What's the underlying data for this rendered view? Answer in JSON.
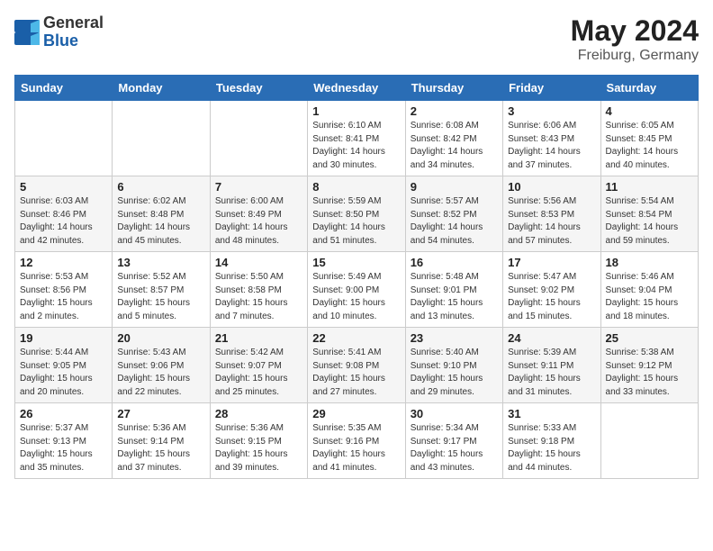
{
  "logo": {
    "general": "General",
    "blue": "Blue"
  },
  "title": {
    "month": "May 2024",
    "location": "Freiburg, Germany"
  },
  "weekdays": [
    "Sunday",
    "Monday",
    "Tuesday",
    "Wednesday",
    "Thursday",
    "Friday",
    "Saturday"
  ],
  "weeks": [
    [
      {
        "day": "",
        "info": ""
      },
      {
        "day": "",
        "info": ""
      },
      {
        "day": "",
        "info": ""
      },
      {
        "day": "1",
        "info": "Sunrise: 6:10 AM\nSunset: 8:41 PM\nDaylight: 14 hours\nand 30 minutes."
      },
      {
        "day": "2",
        "info": "Sunrise: 6:08 AM\nSunset: 8:42 PM\nDaylight: 14 hours\nand 34 minutes."
      },
      {
        "day": "3",
        "info": "Sunrise: 6:06 AM\nSunset: 8:43 PM\nDaylight: 14 hours\nand 37 minutes."
      },
      {
        "day": "4",
        "info": "Sunrise: 6:05 AM\nSunset: 8:45 PM\nDaylight: 14 hours\nand 40 minutes."
      }
    ],
    [
      {
        "day": "5",
        "info": "Sunrise: 6:03 AM\nSunset: 8:46 PM\nDaylight: 14 hours\nand 42 minutes."
      },
      {
        "day": "6",
        "info": "Sunrise: 6:02 AM\nSunset: 8:48 PM\nDaylight: 14 hours\nand 45 minutes."
      },
      {
        "day": "7",
        "info": "Sunrise: 6:00 AM\nSunset: 8:49 PM\nDaylight: 14 hours\nand 48 minutes."
      },
      {
        "day": "8",
        "info": "Sunrise: 5:59 AM\nSunset: 8:50 PM\nDaylight: 14 hours\nand 51 minutes."
      },
      {
        "day": "9",
        "info": "Sunrise: 5:57 AM\nSunset: 8:52 PM\nDaylight: 14 hours\nand 54 minutes."
      },
      {
        "day": "10",
        "info": "Sunrise: 5:56 AM\nSunset: 8:53 PM\nDaylight: 14 hours\nand 57 minutes."
      },
      {
        "day": "11",
        "info": "Sunrise: 5:54 AM\nSunset: 8:54 PM\nDaylight: 14 hours\nand 59 minutes."
      }
    ],
    [
      {
        "day": "12",
        "info": "Sunrise: 5:53 AM\nSunset: 8:56 PM\nDaylight: 15 hours\nand 2 minutes."
      },
      {
        "day": "13",
        "info": "Sunrise: 5:52 AM\nSunset: 8:57 PM\nDaylight: 15 hours\nand 5 minutes."
      },
      {
        "day": "14",
        "info": "Sunrise: 5:50 AM\nSunset: 8:58 PM\nDaylight: 15 hours\nand 7 minutes."
      },
      {
        "day": "15",
        "info": "Sunrise: 5:49 AM\nSunset: 9:00 PM\nDaylight: 15 hours\nand 10 minutes."
      },
      {
        "day": "16",
        "info": "Sunrise: 5:48 AM\nSunset: 9:01 PM\nDaylight: 15 hours\nand 13 minutes."
      },
      {
        "day": "17",
        "info": "Sunrise: 5:47 AM\nSunset: 9:02 PM\nDaylight: 15 hours\nand 15 minutes."
      },
      {
        "day": "18",
        "info": "Sunrise: 5:46 AM\nSunset: 9:04 PM\nDaylight: 15 hours\nand 18 minutes."
      }
    ],
    [
      {
        "day": "19",
        "info": "Sunrise: 5:44 AM\nSunset: 9:05 PM\nDaylight: 15 hours\nand 20 minutes."
      },
      {
        "day": "20",
        "info": "Sunrise: 5:43 AM\nSunset: 9:06 PM\nDaylight: 15 hours\nand 22 minutes."
      },
      {
        "day": "21",
        "info": "Sunrise: 5:42 AM\nSunset: 9:07 PM\nDaylight: 15 hours\nand 25 minutes."
      },
      {
        "day": "22",
        "info": "Sunrise: 5:41 AM\nSunset: 9:08 PM\nDaylight: 15 hours\nand 27 minutes."
      },
      {
        "day": "23",
        "info": "Sunrise: 5:40 AM\nSunset: 9:10 PM\nDaylight: 15 hours\nand 29 minutes."
      },
      {
        "day": "24",
        "info": "Sunrise: 5:39 AM\nSunset: 9:11 PM\nDaylight: 15 hours\nand 31 minutes."
      },
      {
        "day": "25",
        "info": "Sunrise: 5:38 AM\nSunset: 9:12 PM\nDaylight: 15 hours\nand 33 minutes."
      }
    ],
    [
      {
        "day": "26",
        "info": "Sunrise: 5:37 AM\nSunset: 9:13 PM\nDaylight: 15 hours\nand 35 minutes."
      },
      {
        "day": "27",
        "info": "Sunrise: 5:36 AM\nSunset: 9:14 PM\nDaylight: 15 hours\nand 37 minutes."
      },
      {
        "day": "28",
        "info": "Sunrise: 5:36 AM\nSunset: 9:15 PM\nDaylight: 15 hours\nand 39 minutes."
      },
      {
        "day": "29",
        "info": "Sunrise: 5:35 AM\nSunset: 9:16 PM\nDaylight: 15 hours\nand 41 minutes."
      },
      {
        "day": "30",
        "info": "Sunrise: 5:34 AM\nSunset: 9:17 PM\nDaylight: 15 hours\nand 43 minutes."
      },
      {
        "day": "31",
        "info": "Sunrise: 5:33 AM\nSunset: 9:18 PM\nDaylight: 15 hours\nand 44 minutes."
      },
      {
        "day": "",
        "info": ""
      }
    ]
  ]
}
